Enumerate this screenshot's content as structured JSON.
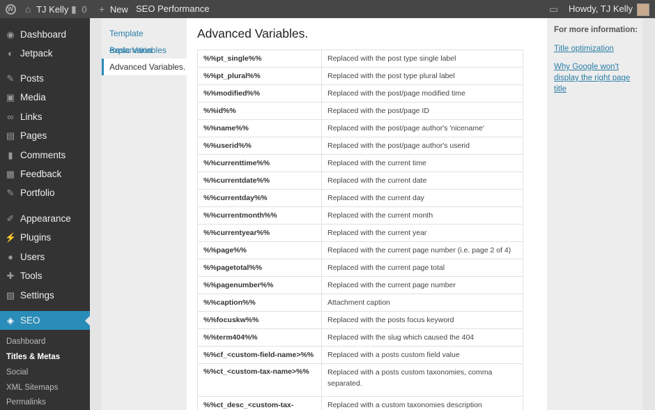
{
  "adminbar": {
    "site_name": "TJ Kelly",
    "comments_count": "0",
    "new_label": "New",
    "seo_label": "SEO",
    "performance_label": "Performance",
    "howdy": "Howdy, TJ Kelly"
  },
  "sidebar": {
    "items": [
      {
        "label": "Dashboard",
        "icon": "dashboard-icon"
      },
      {
        "label": "Jetpack",
        "icon": "jetpack-icon"
      },
      {
        "label": "Posts",
        "icon": "pin-icon"
      },
      {
        "label": "Media",
        "icon": "media-icon"
      },
      {
        "label": "Links",
        "icon": "link-icon"
      },
      {
        "label": "Pages",
        "icon": "pages-icon"
      },
      {
        "label": "Comments",
        "icon": "comments-icon"
      },
      {
        "label": "Feedback",
        "icon": "feedback-icon"
      },
      {
        "label": "Portfolio",
        "icon": "pin-icon"
      },
      {
        "label": "Appearance",
        "icon": "brush-icon"
      },
      {
        "label": "Plugins",
        "icon": "plug-icon"
      },
      {
        "label": "Users",
        "icon": "user-icon"
      },
      {
        "label": "Tools",
        "icon": "wrench-icon"
      },
      {
        "label": "Settings",
        "icon": "settings-icon"
      },
      {
        "label": "SEO",
        "icon": "seo-icon"
      }
    ],
    "submenu": [
      "Dashboard",
      "Titles & Metas",
      "Social",
      "XML Sitemaps",
      "Permalinks"
    ]
  },
  "help_tabs": [
    "Template explanation",
    "Basic Variables",
    "Advanced Variables."
  ],
  "main": {
    "title": "Advanced Variables.",
    "rows": [
      {
        "code": "%%pt_single%%",
        "desc": "Replaced with the post type single label"
      },
      {
        "code": "%%pt_plural%%",
        "desc": "Replaced with the post type plural label"
      },
      {
        "code": "%%modified%%",
        "desc": "Replaced with the post/page modified time"
      },
      {
        "code": "%%id%%",
        "desc": "Replaced with the post/page ID"
      },
      {
        "code": "%%name%%",
        "desc": "Replaced with the post/page author's 'nicename'"
      },
      {
        "code": "%%userid%%",
        "desc": "Replaced with the post/page author's userid"
      },
      {
        "code": "%%currenttime%%",
        "desc": "Replaced with the current time"
      },
      {
        "code": "%%currentdate%%",
        "desc": "Replaced with the current date"
      },
      {
        "code": "%%currentday%%",
        "desc": "Replaced with the current day"
      },
      {
        "code": "%%currentmonth%%",
        "desc": "Replaced with the current month"
      },
      {
        "code": "%%currentyear%%",
        "desc": "Replaced with the current year"
      },
      {
        "code": "%%page%%",
        "desc": "Replaced with the current page number (i.e. page 2 of 4)"
      },
      {
        "code": "%%pagetotal%%",
        "desc": "Replaced with the current page total"
      },
      {
        "code": "%%pagenumber%%",
        "desc": "Replaced with the current page number"
      },
      {
        "code": "%%caption%%",
        "desc": "Attachment caption"
      },
      {
        "code": "%%focuskw%%",
        "desc": "Replaced with the posts focus keyword"
      },
      {
        "code": "%%term404%%",
        "desc": "Replaced with the slug which caused the 404"
      },
      {
        "code": "%%cf_<custom-field-name>%%",
        "desc": "Replaced with a posts custom field value"
      },
      {
        "code": "%%ct_<custom-tax-name>%%",
        "desc": "Replaced with a posts custom taxonomies, comma separated."
      },
      {
        "code": "%%ct_desc_<custom-tax-",
        "desc": "Replaced with a custom taxonomies description"
      }
    ]
  },
  "help_sidebar": {
    "title": "For more information:",
    "links": [
      "Title optimization",
      "Why Google won't display the right page title"
    ]
  },
  "colors": {
    "accent": "#2a8cb8",
    "link": "#2a7ea8",
    "sidebar_bg": "#333333",
    "adminbar_bg": "#464646"
  }
}
